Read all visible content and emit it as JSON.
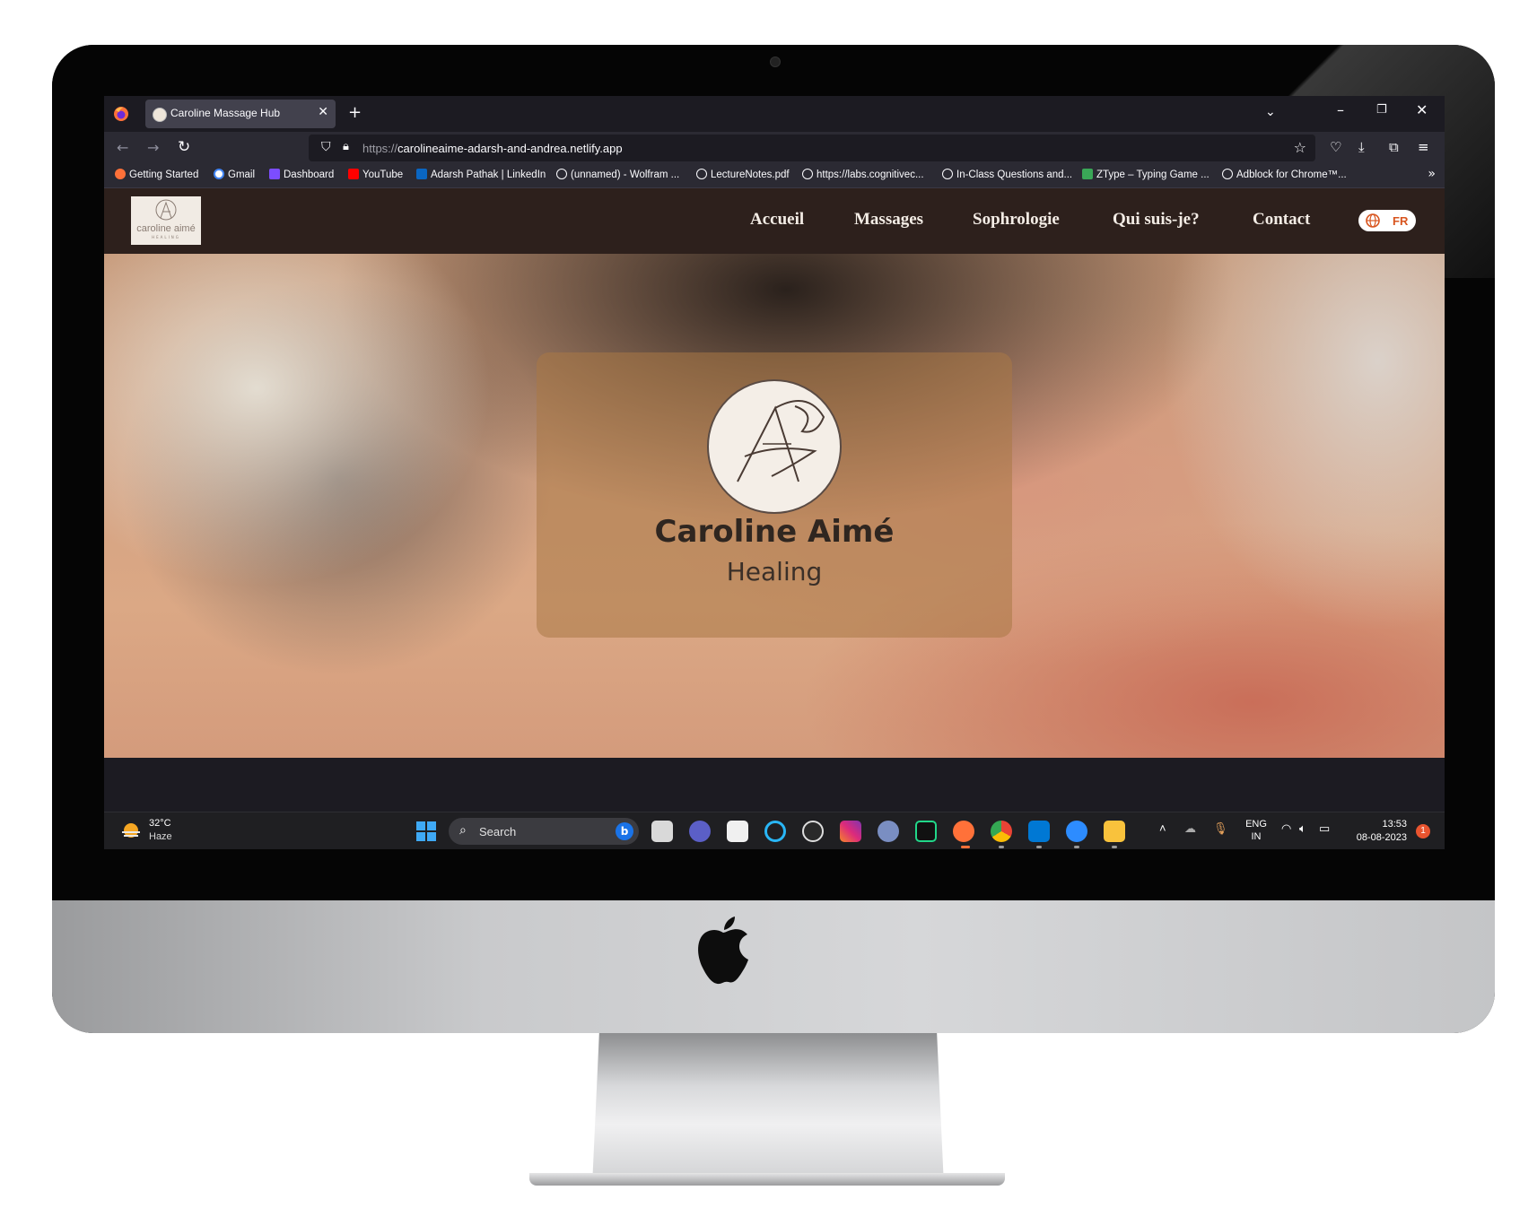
{
  "browser": {
    "tab_title": "Caroline Massage Hub",
    "url_scheme": "https://",
    "url_host": "carolineaime-adarsh-and-andrea.netlify.app",
    "bookmarks": [
      {
        "label": "Getting Started",
        "icon": "firefox-icon"
      },
      {
        "label": "Gmail",
        "icon": "google-icon"
      },
      {
        "label": "Dashboard",
        "icon": "dashboard-icon"
      },
      {
        "label": "YouTube",
        "icon": "youtube-icon"
      },
      {
        "label": "Adarsh Pathak | LinkedIn",
        "icon": "linkedin-icon"
      },
      {
        "label": "(unnamed) - Wolfram ...",
        "icon": "globe-icon"
      },
      {
        "label": "LectureNotes.pdf",
        "icon": "globe-icon"
      },
      {
        "label": "https://labs.cognitivec...",
        "icon": "globe-icon"
      },
      {
        "label": "In-Class Questions and...",
        "icon": "globe-icon"
      },
      {
        "label": "ZType – Typing Game ...",
        "icon": "ztype-icon"
      },
      {
        "label": "Adblock for Chrome™...",
        "icon": "globe-icon"
      }
    ]
  },
  "site": {
    "logo_text": "caroline aimé",
    "logo_sub": "HEALING",
    "menu": [
      "Accueil",
      "Massages",
      "Sophrologie",
      "Qui suis-je?",
      "Contact"
    ],
    "lang": "FR",
    "hero_name": "Caroline Aimé",
    "hero_sub": "Healing"
  },
  "taskbar": {
    "temp": "32°C",
    "weather": "Haze",
    "search_label": "Search",
    "lang_line1": "ENG",
    "lang_line2": "IN",
    "time": "13:53",
    "date": "08-08-2023",
    "notifications": "1"
  },
  "colors": {
    "site_header": "#2d201c",
    "lang_accent": "#d8551f",
    "browser_bg": "#1c1b22"
  }
}
